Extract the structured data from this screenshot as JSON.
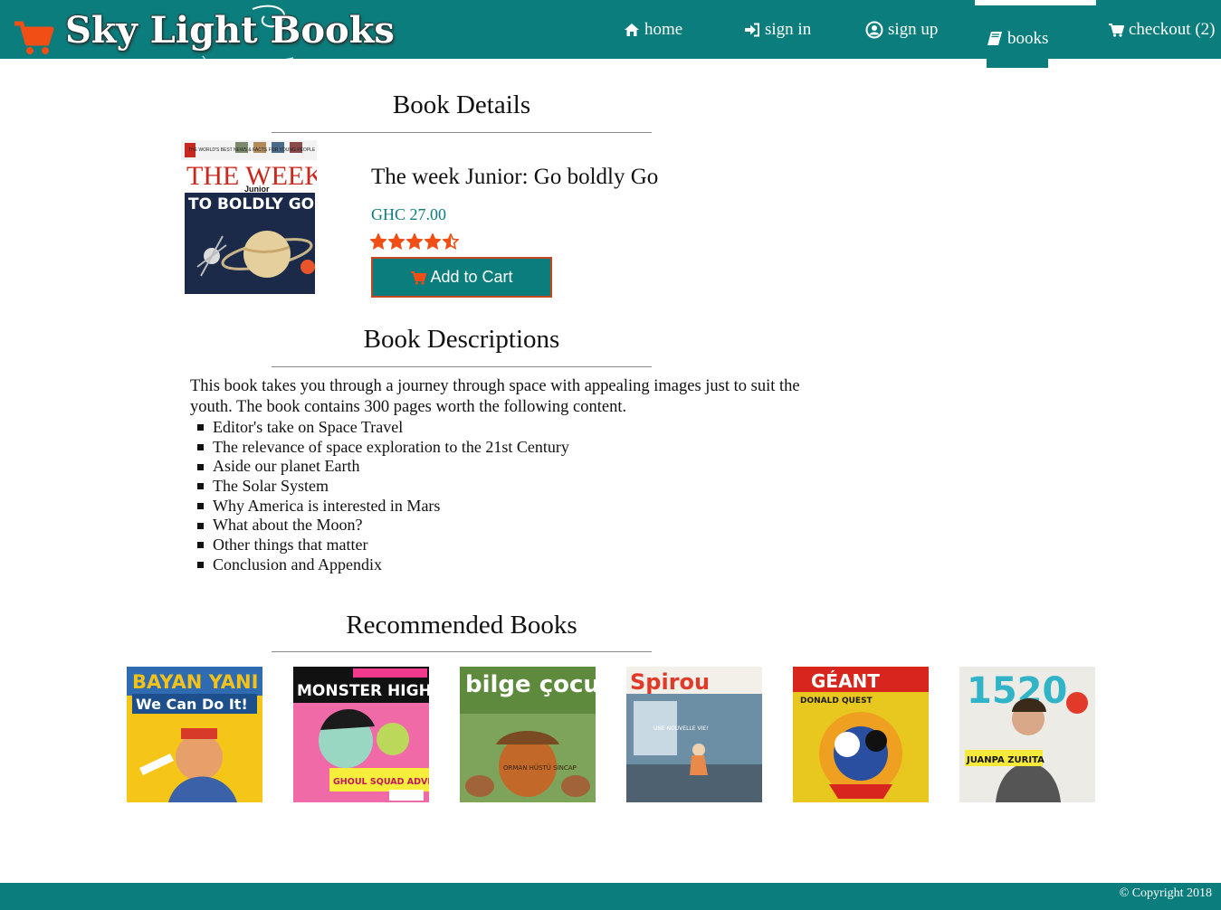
{
  "brand": {
    "name": "Sky Light Books"
  },
  "nav": {
    "home": "home",
    "sign_in": "sign in",
    "sign_up": "sign up",
    "books": "books",
    "checkout": "checkout (2)"
  },
  "details": {
    "heading": "Book Details",
    "cover_text": {
      "top": "THE WORLD'S BEST NEWS & FACTS FOR YOUNG PEOPLE",
      "masthead": "THE WEEK",
      "sub": "Junior",
      "headline": "TO BOLDLY GO"
    },
    "title": "The week Junior: Go boldly Go",
    "price": "GHC 27.00",
    "rating": 4.5,
    "rating_max": 5,
    "add_to_cart": "Add to Cart"
  },
  "descriptions": {
    "heading": "Book Descriptions",
    "intro": "This book takes you through a journey through space with appealing images just to suit the youth. The book contains 300 pages worth the following content.",
    "items": [
      "Editor's take on Space Travel",
      "The relevance of space exploration to the 21st Century",
      "Aside our planet Earth",
      "The Solar System",
      "Why America is interested in Mars",
      "What about the Moon?",
      "Other things that matter",
      "Conclusion and Appendix"
    ]
  },
  "recommended": {
    "heading": "Recommended Books",
    "books": [
      {
        "title": "BAYAN YANI",
        "tagline": "We Can Do It!"
      },
      {
        "title": "MONSTER HIGH",
        "tagline": "GHOUL SQUAD ADVENTURE"
      },
      {
        "title": "bilge çocuk",
        "tagline": "ORMAN HÜSTÜ SİNCAP"
      },
      {
        "title": "Spirou",
        "tagline": "UNE NOUVELLE VIE!"
      },
      {
        "title": "GÉANT",
        "tagline": "DONALD QUEST"
      },
      {
        "title": "1520",
        "tagline": "JUANPA ZURITA"
      }
    ]
  },
  "footer": {
    "copyright": "© Copyright 2018"
  },
  "colors": {
    "primary": "#0b7d7d",
    "accent": "#f04e14",
    "button_border": "#c6461d"
  }
}
